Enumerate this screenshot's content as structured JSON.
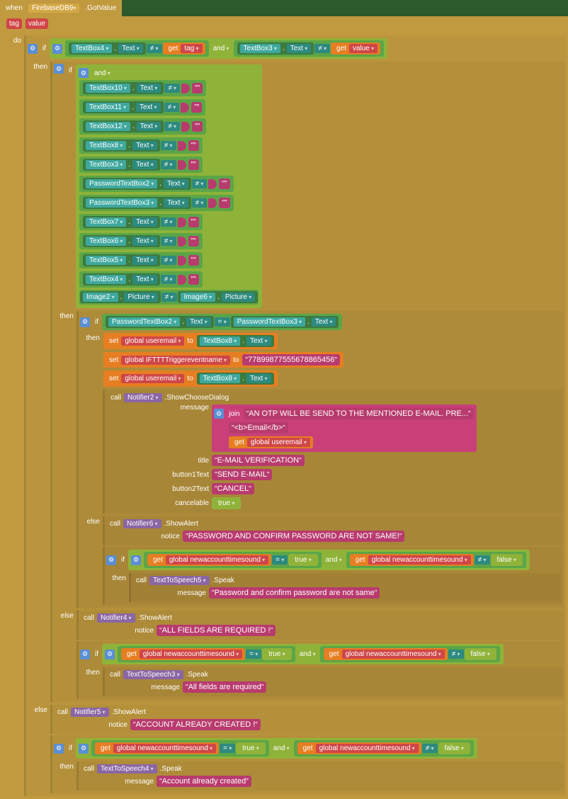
{
  "event": {
    "when": "when",
    "component": "FirebaseDB9",
    "handler": ".GotValue",
    "params": [
      "tag",
      "value"
    ]
  },
  "kw": {
    "do": "do",
    "if": "if",
    "then": "then",
    "else": "else",
    "and": "and",
    "set": "set",
    "to": "to",
    "get": "get",
    "call": "call"
  },
  "cond1": {
    "tb4": "TextBox4",
    "text": "Text",
    "ne": "≠",
    "tag": "tag",
    "tb3": "TextBox3",
    "value": "value"
  },
  "cond2": {
    "items": [
      {
        "comp": "TextBox10",
        "prop": "Text",
        "val": ""
      },
      {
        "comp": "TextBox11",
        "prop": "Text",
        "val": ""
      },
      {
        "comp": "TextBox12",
        "prop": "Text",
        "val": ""
      },
      {
        "comp": "TextBox8",
        "prop": "Text",
        "val": ""
      },
      {
        "comp": "TextBox3",
        "prop": "Text",
        "val": ""
      },
      {
        "comp": "PasswordTextBox2",
        "prop": "Text",
        "val": ""
      },
      {
        "comp": "PasswordTextBox3",
        "prop": "Text",
        "val": ""
      },
      {
        "comp": "TextBox7",
        "prop": "Text",
        "val": ""
      },
      {
        "comp": "TextBox6",
        "prop": "Text",
        "val": ""
      },
      {
        "comp": "TextBox5",
        "prop": "Text",
        "val": ""
      },
      {
        "comp": "TextBox4",
        "prop": "Text",
        "val": ""
      }
    ],
    "img": {
      "comp1": "Image2",
      "prop": "Picture",
      "comp2": "Image6"
    }
  },
  "cond3": {
    "p1": "PasswordTextBox2",
    "p2": "PasswordTextBox3",
    "eq": "="
  },
  "sets": [
    {
      "var": "global useremail",
      "src": "TextBox8",
      "prop": "Text"
    },
    {
      "var": "global IFTTTTriggereventname",
      "lit": "77899877555678865456"
    },
    {
      "var": "global useremail",
      "src": "TextBox8",
      "prop": "Text"
    }
  ],
  "dialog": {
    "comp": "Notifier2",
    "method": ".ShowChooseDialog",
    "msgLabel": "message",
    "join": "join",
    "lines": [
      "AN OTP WILL BE SEND TO THE MENTIONED E-MAIL. PRE...",
      "<b>Email</b>"
    ],
    "getvar": "global useremail",
    "title": {
      "lbl": "title",
      "val": "E-MAIL VERIFICATION"
    },
    "b1": {
      "lbl": "button1Text",
      "val": "SEND E-MAIL"
    },
    "b2": {
      "lbl": "button2Text",
      "val": "CANCEL"
    },
    "cancel": {
      "lbl": "cancelable",
      "val": "true"
    }
  },
  "else1": {
    "comp": "Notifier6",
    "method": ".ShowAlert",
    "noticeLbl": "notice",
    "notice": "PASSWORD AND CONFIRM PASSWORD ARE NOT SAME!",
    "var": "global newaccounttimesound",
    "true": "true",
    "false": "false",
    "tts": "TextToSpeech5",
    "ttsMethod": ".Speak",
    "msgLbl": "message",
    "msg": "Password and confirm password are not same"
  },
  "else2": {
    "comp": "Notifier4",
    "method": ".ShowAlert",
    "noticeLbl": "notice",
    "notice": "ALL FIELDS ARE REQUIRED !",
    "var": "global newaccounttimesound",
    "true": "true",
    "false": "false",
    "tts": "TextToSpeech3",
    "ttsMethod": ".Speak",
    "msgLbl": "message",
    "msg": "All fields are required"
  },
  "else3": {
    "comp": "Notifier5",
    "method": ".ShowAlert",
    "noticeLbl": "notice",
    "notice": "ACCOUNT ALREADY CREATED !",
    "var": "global newaccounttimesound",
    "true": "true",
    "false": "false",
    "tts": "TextToSpeech4",
    "ttsMethod": ".Speak",
    "msgLbl": "message",
    "msg": "Account already created"
  }
}
